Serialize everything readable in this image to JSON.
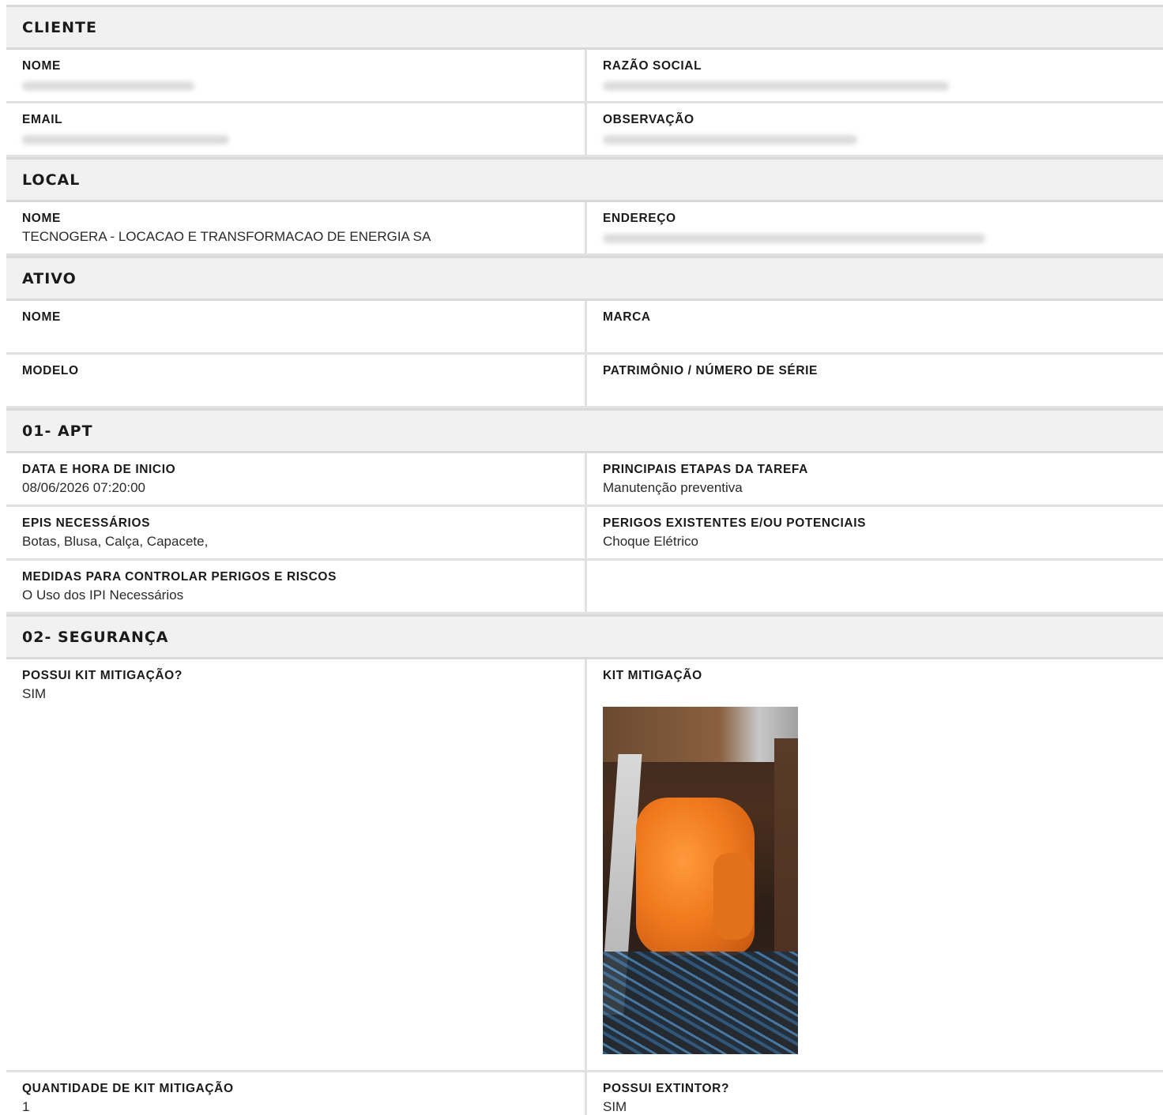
{
  "sections": {
    "cliente": {
      "title": "CLIENTE",
      "nome_label": "NOME",
      "razao_label": "RAZÃO SOCIAL",
      "email_label": "EMAIL",
      "observacao_label": "OBSERVAÇÃO"
    },
    "local": {
      "title": "LOCAL",
      "nome_label": "NOME",
      "nome_value": "TECNOGERA - LOCACAO E TRANSFORMACAO DE ENERGIA SA",
      "endereco_label": "ENDEREÇO"
    },
    "ativo": {
      "title": "ATIVO",
      "nome_label": "NOME",
      "marca_label": "MARCA",
      "modelo_label": "MODELO",
      "patrimonio_label": "PATRIMÔNIO / NÚMERO DE SÉRIE"
    },
    "apt": {
      "title": "01- APT",
      "data_label": "DATA E HORA DE INICIO",
      "data_value": "08/06/2026 07:20:00",
      "etapas_label": "PRINCIPAIS ETAPAS DA TAREFA",
      "etapas_value": "Manutenção preventiva",
      "epis_label": "EPIS NECESSÁRIOS",
      "epis_value": "Botas, Blusa, Calça, Capacete,",
      "perigos_label": "PERIGOS EXISTENTES E/OU POTENCIAIS",
      "perigos_value": "Choque Elétrico",
      "medidas_label": "MEDIDAS PARA CONTROLAR PERIGOS E RISCOS",
      "medidas_value": "O Uso dos IPI Necessários"
    },
    "seguranca": {
      "title": "02- SEGURANÇA",
      "possui_kit_label": "POSSUI KIT MITIGAÇÃO?",
      "possui_kit_value": "SIM",
      "kit_label": "KIT MITIGAÇÃO",
      "quantidade_label": "QUANTIDADE DE KIT MITIGAÇÃO",
      "quantidade_value": "1",
      "extintor_label": "POSSUI EXTINTOR?",
      "extintor_value": "SIM"
    }
  }
}
